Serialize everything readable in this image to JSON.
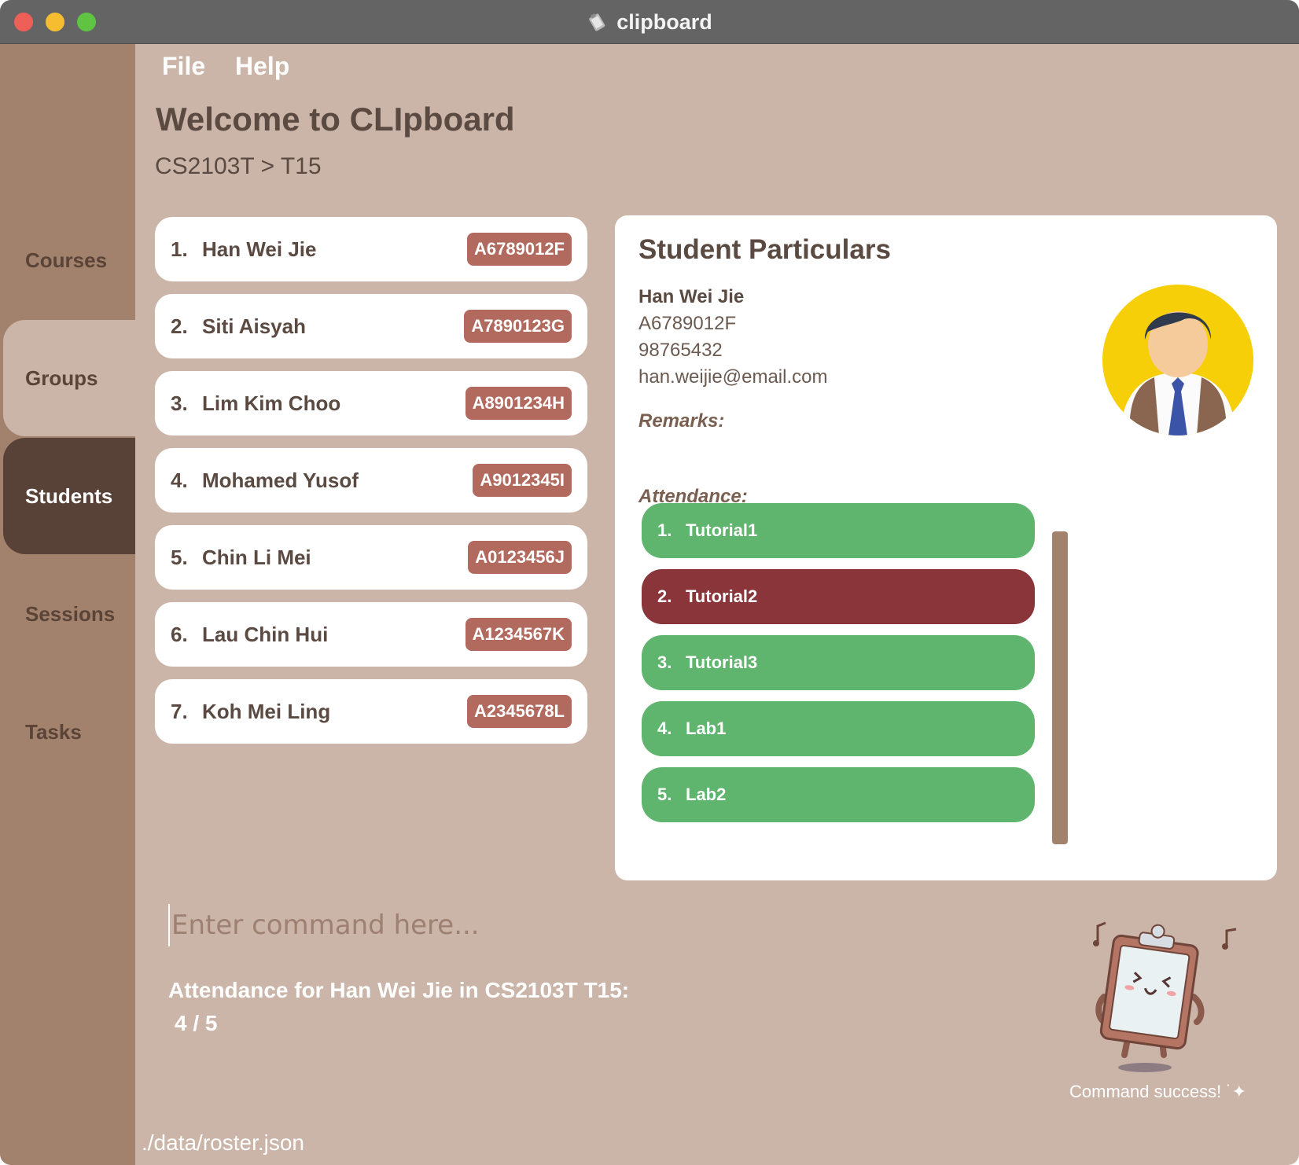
{
  "window": {
    "title": "clipboard"
  },
  "sidebar": {
    "items": [
      {
        "label": "Courses",
        "active": false
      },
      {
        "label": "Groups",
        "active": false
      },
      {
        "label": "Students",
        "active": true
      },
      {
        "label": "Sessions",
        "active": false
      },
      {
        "label": "Tasks",
        "active": false
      }
    ]
  },
  "menu": {
    "file": "File",
    "help": "Help"
  },
  "header": {
    "title": "Welcome to CLIpboard",
    "breadcrumb": "CS2103T > T15"
  },
  "students": [
    {
      "index": "1.",
      "name": "Han Wei Jie",
      "id": "A6789012F"
    },
    {
      "index": "2.",
      "name": "Siti Aisyah",
      "id": "A7890123G"
    },
    {
      "index": "3.",
      "name": "Lim Kim Choo",
      "id": "A8901234H"
    },
    {
      "index": "4.",
      "name": "Mohamed Yusof",
      "id": "A9012345I"
    },
    {
      "index": "5.",
      "name": "Chin Li Mei",
      "id": "A0123456J"
    },
    {
      "index": "6.",
      "name": "Lau Chin Hui",
      "id": "A1234567K"
    },
    {
      "index": "7.",
      "name": "Koh Mei Ling",
      "id": "A2345678L"
    }
  ],
  "particulars": {
    "title": "Student Particulars",
    "name": "Han Wei Jie",
    "id": "A6789012F",
    "phone": "98765432",
    "email": "han.weijie@email.com",
    "remarks_label": "Remarks:",
    "attendance_label": "Attendance:",
    "attendance": [
      {
        "index": "1.",
        "session": "Tutorial1",
        "present": true
      },
      {
        "index": "2.",
        "session": "Tutorial2",
        "present": false
      },
      {
        "index": "3.",
        "session": "Tutorial3",
        "present": true
      },
      {
        "index": "4.",
        "session": "Lab1",
        "present": true
      },
      {
        "index": "5.",
        "session": "Lab2",
        "present": true
      }
    ]
  },
  "command": {
    "placeholder": "Enter command here...",
    "result_line1": "Attendance for Han Wei Jie in CS2103T T15:",
    "result_line2": "4 / 5"
  },
  "mascot": {
    "caption": "Command success! ˙✦"
  },
  "status": {
    "filepath": "./data/roster.json"
  },
  "colors": {
    "background": "#cbb5a8",
    "sidebar": "#a3826d",
    "active_tab": "#584237",
    "id_badge": "#b2695e",
    "present": "#5fb56d",
    "absent": "#8a3539"
  }
}
